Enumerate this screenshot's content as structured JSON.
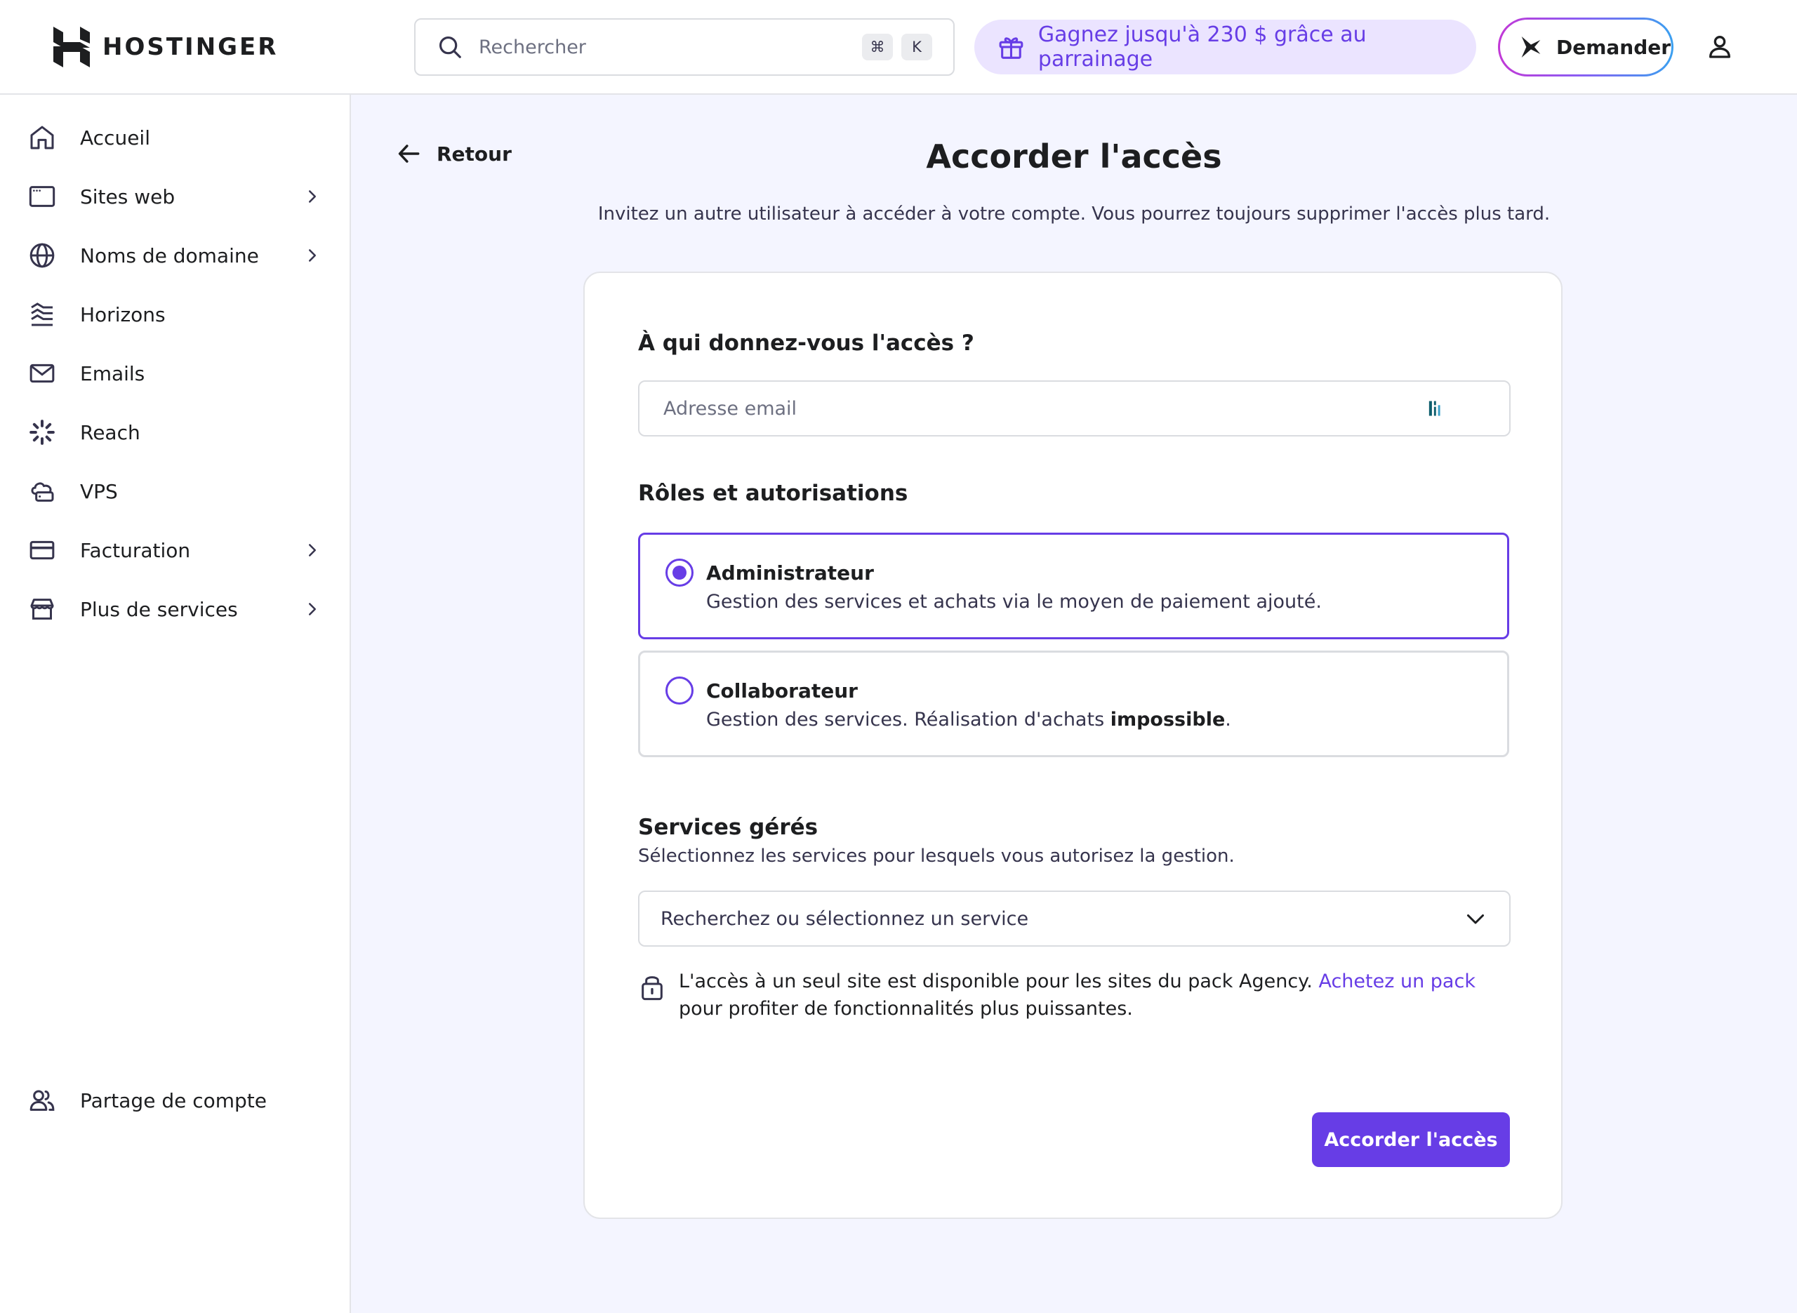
{
  "app": {
    "brand": "HOSTINGER"
  },
  "header": {
    "search_placeholder": "Rechercher",
    "shortcut_keys": [
      "⌘",
      "K"
    ],
    "promo_text": "Gagnez jusqu'à 230 $ grâce au parrainage",
    "ask_label": "Demander"
  },
  "sidebar": {
    "items": [
      {
        "label": "Accueil",
        "icon": "home-icon",
        "has_submenu": false
      },
      {
        "label": "Sites web",
        "icon": "browser-window-icon",
        "has_submenu": true
      },
      {
        "label": "Noms de domaine",
        "icon": "globe-icon",
        "has_submenu": true
      },
      {
        "label": "Horizons",
        "icon": "horizons-icon",
        "has_submenu": false
      },
      {
        "label": "Emails",
        "icon": "mail-icon",
        "has_submenu": false
      },
      {
        "label": "Reach",
        "icon": "reach-icon",
        "has_submenu": false
      },
      {
        "label": "VPS",
        "icon": "cloud-server-icon",
        "has_submenu": false
      },
      {
        "label": "Facturation",
        "icon": "credit-card-icon",
        "has_submenu": true
      },
      {
        "label": "Plus de services",
        "icon": "store-icon",
        "has_submenu": true
      }
    ],
    "bottom_item": {
      "label": "Partage de compte",
      "icon": "users-icon"
    }
  },
  "main": {
    "back_label": "Retour",
    "title": "Accorder l'accès",
    "subtitle": "Invitez un autre utilisateur à accéder à votre compte. Vous pourrez toujours supprimer l'accès plus tard.",
    "recipient": {
      "heading": "À qui donnez-vous l'accès ?",
      "email_placeholder": "Adresse email",
      "email_value": ""
    },
    "roles": {
      "heading": "Rôles et autorisations",
      "selected": "Administrateur",
      "options": [
        {
          "title": "Administrateur",
          "description": "Gestion des services et achats via le moyen de paiement ajouté.",
          "checked": true
        },
        {
          "title": "Collaborateur",
          "description_prefix": "Gestion des services. Réalisation d'achats ",
          "description_bold": "impossible",
          "description_suffix": ".",
          "checked": false
        }
      ]
    },
    "services": {
      "heading": "Services gérés",
      "subheading": "Sélectionnez les services pour lesquels vous autorisez la gestion.",
      "select_placeholder": "Recherchez ou sélectionnez un service",
      "note_prefix": "L'accès à un seul site est disponible pour les sites du pack Agency. ",
      "note_link": "Achetez un pack",
      "note_suffix": " pour profiter de fonctionnalités plus puissantes."
    },
    "submit_label": "Accorder l'accès"
  },
  "colors": {
    "accent": "#673de6",
    "promo_bg": "#ebe4ff",
    "page_bg": "#f4f5ff"
  }
}
